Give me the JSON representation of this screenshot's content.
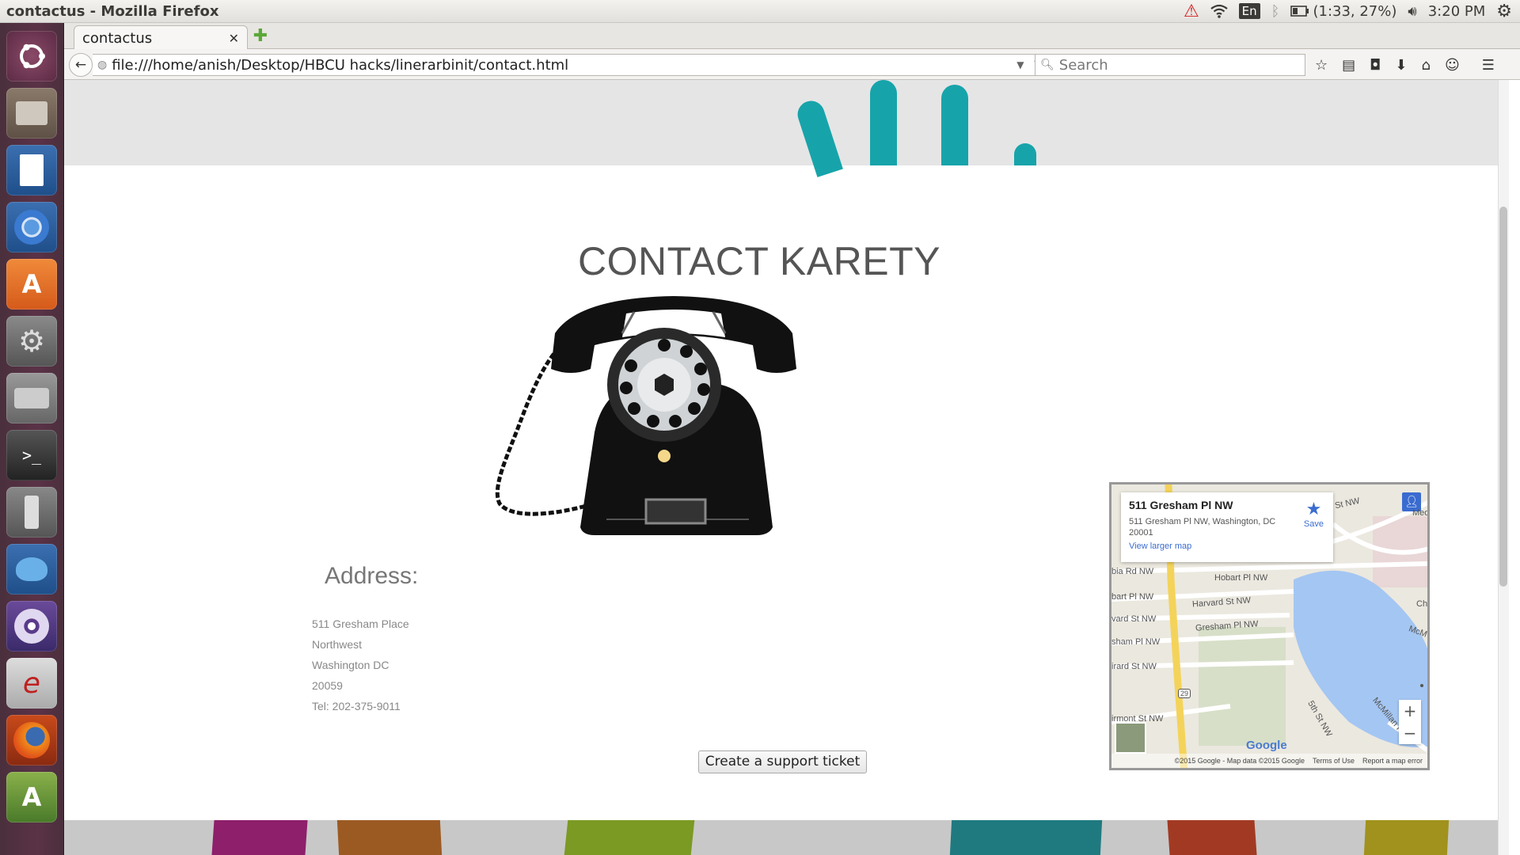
{
  "system": {
    "window_title": "contactus - Mozilla Firefox",
    "keyboard_layout": "En",
    "battery_text": "(1:33, 27%)",
    "clock": "3:20 PM"
  },
  "browser": {
    "tab_title": "contactus",
    "url": "file:///home/anish/Desktop/HBCU hacks/linerarbinit/contact.html",
    "search_placeholder": "Search"
  },
  "page": {
    "heading": "CONTACT KARETY",
    "address_heading": "Address:",
    "address_lines": [
      "511 Gresham Place",
      "Northwest",
      "Washington DC",
      "20059",
      "Tel: 202-375-9011"
    ],
    "ticket_button": "Create a support ticket"
  },
  "map": {
    "place_title": "511 Gresham Pl NW",
    "place_address": "511 Gresham Pl NW, Washington, DC 20001",
    "view_larger": "View larger map",
    "save_label": "Save",
    "streets": [
      "Hobart Pl NW",
      "Harvard St NW",
      "Gresham Pl NW",
      "bia Rd NW",
      "bart Pl NW",
      "vard St NW",
      "sham Pl NW",
      "irard St NW",
      "irmont St NW",
      "5th St NW",
      "McMillan Res",
      "St NW",
      "Ch",
      "McM",
      "Med St"
    ],
    "route_shield": "29",
    "zoom_in": "+",
    "zoom_out": "−",
    "google_logo": "Google",
    "attribution": "©2015 Google - Map data ©2015 Google",
    "terms": "Terms of Use",
    "report": "Report a map error"
  },
  "colors": {
    "teal": "#16a4aa",
    "launcher_bg": "#5b3247",
    "footer_stripes": [
      "#8e1f6b",
      "#9c5a23",
      "#7a9a23",
      "#1f7a80",
      "#a23a23",
      "#a0921c"
    ]
  }
}
